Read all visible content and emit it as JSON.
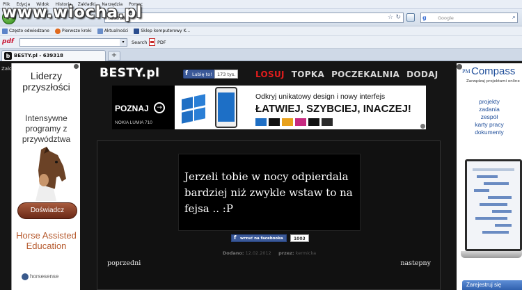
{
  "watermark": "www.wiocha.pl",
  "menu": [
    "Plik",
    "Edycja",
    "Widok",
    "Historia",
    "Zakładki",
    "Narzędzia",
    "Pomoc"
  ],
  "urlbar": {
    "value": "639318"
  },
  "searchbar": {
    "placeholder": "Google"
  },
  "bookmarks": [
    {
      "label": "Często odwiedzane",
      "color": "#5b83c9"
    },
    {
      "label": "Pierwsze kroki",
      "color": "#e06a1e"
    },
    {
      "label": "Aktualności",
      "color": "#6a8ec9"
    },
    {
      "label": "Sklep komputerowy K...",
      "color": "#2a4d8f"
    }
  ],
  "pdfbar": {
    "logo": "pdf",
    "search_label": "Search",
    "pdf_label": "PDF"
  },
  "tab": {
    "favicon": "b",
    "title": "BESTY.pl - 639318",
    "new_tab": "+"
  },
  "page": {
    "zalo": "Zalo",
    "left_ad": {
      "title": "Liderzy przyszłości",
      "subtitle": "Intensywne programy z przywództwa",
      "button": "Doświadcz",
      "horse_text": "Horse Assisted Education",
      "brand": "horsesense"
    },
    "right_ad": {
      "pm": "PM",
      "brand": "Compass",
      "tagline": "Zarządzaj projektami online",
      "features": [
        "projekty",
        "zadania",
        "zespół",
        "karty pracy",
        "dokumenty"
      ],
      "button": "Zarejestruj się"
    },
    "site": {
      "logo": "BESTY.pl",
      "fb_like": "Lubię to!",
      "fb_count": "173 tys.",
      "nav": [
        "LOSUJ",
        "TOPKA",
        "POCZEKALNIA",
        "DODAJ"
      ]
    },
    "banner": {
      "poznaj": "POZNAJ",
      "arrow": "→",
      "lumia": "NOKIA LUMIA 710",
      "headline": "Odkryj unikatowy design i nowy interfejs",
      "main": "ŁATWIEJ, SZYBCIEJ, INACZEJ!",
      "colors": [
        "#1f6fc4",
        "#111111",
        "#e8a11c",
        "#c62a80",
        "#111111",
        "#2a2a2a"
      ]
    },
    "post": {
      "text": "Jerzeli tobie w nocy odpierdala bardziej niż zwykle wstaw to na fejsa .. :P",
      "share": "wrzuć na facebooka",
      "share_count": "1003",
      "added_label": "Dodano:",
      "added_date": "12.02.2012",
      "author_label": "przez:",
      "author": "kermicka",
      "prev": "poprzedni",
      "next": "nastepny"
    }
  }
}
